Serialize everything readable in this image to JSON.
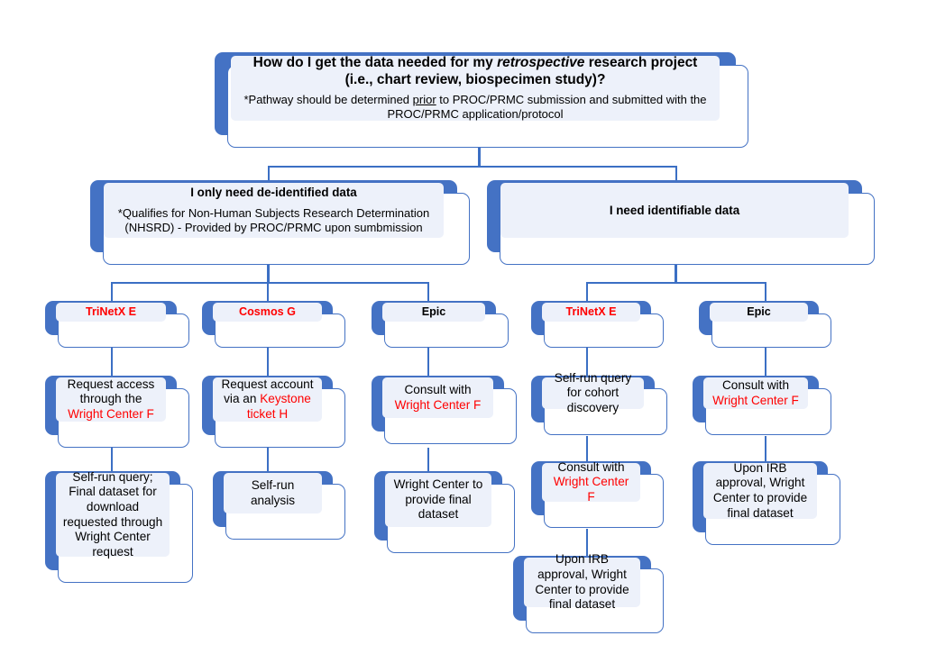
{
  "colors": {
    "plate": "#4472C4",
    "line": "#3B6FC4",
    "inner_fill": "#EDF1FA",
    "accent_red": "#FF0000",
    "text": "#000000"
  },
  "chart_data": {
    "type": "diagram",
    "title": "Retrospective research data request pathway flowchart",
    "layout": "top-down tree, 5 levels"
  },
  "root": {
    "heading_pre": "How do I get the data needed for my ",
    "heading_italic": "retrospective",
    "heading_post": " research project (i.e., chart review, biospecimen study)?",
    "note_pre": "*Pathway should be determined ",
    "note_underline": "prior",
    "note_post": " to PROC/PRMC submission and submitted with the PROC/PRMC application/protocol"
  },
  "branches": {
    "deidentified": {
      "title": "I only need de-identified data",
      "note": "*Qualifies for Non-Human Subjects Research Determination (NHSRD) - Provided by PROC/PRMC upon sumbmission"
    },
    "identifiable": {
      "title": "I need identifiable data"
    }
  },
  "columns": {
    "trinetx_deid": {
      "header": "TriNetX E",
      "header_color": "red",
      "step1_pre": "Request access through the ",
      "step1_red": "Wright Center F",
      "step2": "Self-run query; Final dataset for download requested through Wright Center request"
    },
    "cosmos": {
      "header": "Cosmos G",
      "header_color": "red",
      "step1_pre": "Request account via an ",
      "step1_red": "Keystone ticket H",
      "step2": "Self-run analysis"
    },
    "epic_deid": {
      "header": "Epic",
      "header_color": "black",
      "step1_pre": "Consult with ",
      "step1_red": "Wright Center F",
      "step2": "Wright Center to provide final dataset"
    },
    "trinetx_ident": {
      "header": "TriNetX E",
      "header_color": "red",
      "step1": "Self-run query for cohort discovery",
      "step2_pre": "Consult with ",
      "step2_red": "Wright Center F",
      "step3": "Upon IRB approval, Wright Center to provide final dataset"
    },
    "epic_ident": {
      "header": "Epic",
      "header_color": "black",
      "step1_pre": "Consult with ",
      "step1_red": "Wright Center F",
      "step2": "Upon IRB approval, Wright Center to provide final dataset"
    }
  }
}
